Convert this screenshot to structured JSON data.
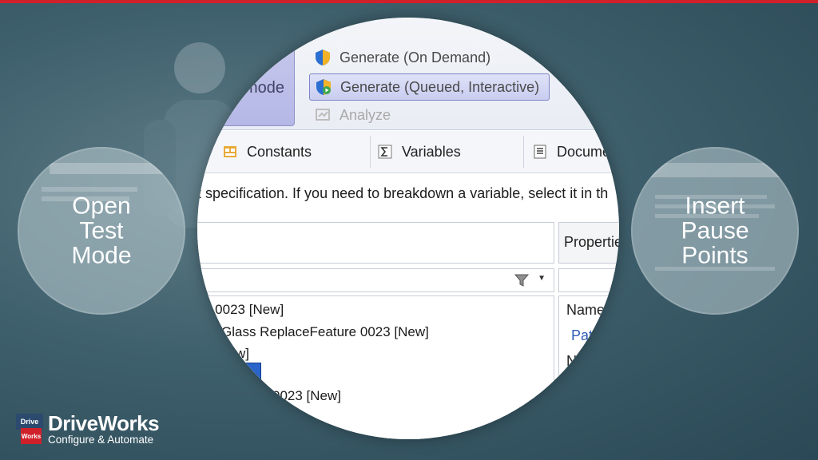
{
  "left_circle": {
    "lines": [
      "Open",
      "Test",
      "Mode"
    ]
  },
  "right_circle": {
    "lines": [
      "Insert",
      "Pause",
      "Points"
    ]
  },
  "ribbon": {
    "mode_label": "mode",
    "items": [
      {
        "label": "Generate (On Demand)",
        "icon": "shield-icon"
      },
      {
        "label": "Generate (Queued, Interactive)",
        "icon": "shield-play-icon",
        "highlighted": true
      },
      {
        "label": "Analyze",
        "icon": "analyze-icon",
        "disabled": true
      }
    ]
  },
  "tabs": [
    {
      "label": "Constants",
      "icon": "constants-icon"
    },
    {
      "label": "Variables",
      "icon": "sigma-icon"
    },
    {
      "label": "Docume",
      "icon": "document-icon"
    }
  ],
  "description": "t specification. If you need to breakdown a variable, select it in th",
  "properties_header": "Propertie",
  "tree_items": [
    "e 0023 [New]",
    "Glass ReplaceFeature 0023 [New]",
    "w]",
    "",
    "ture 0023 [New]"
  ],
  "properties": {
    "name_label": "Name",
    "name_value": "Pat",
    "next_label": "N"
  },
  "logo": {
    "mark_top": "Drive",
    "mark_bottom": "Works",
    "name": "DriveWorks",
    "tagline": "Configure & Automate"
  },
  "colors": {
    "brand_red": "#d0212b",
    "brand_navy": "#2b4a6e",
    "highlight_blue": "#2a64c9"
  }
}
